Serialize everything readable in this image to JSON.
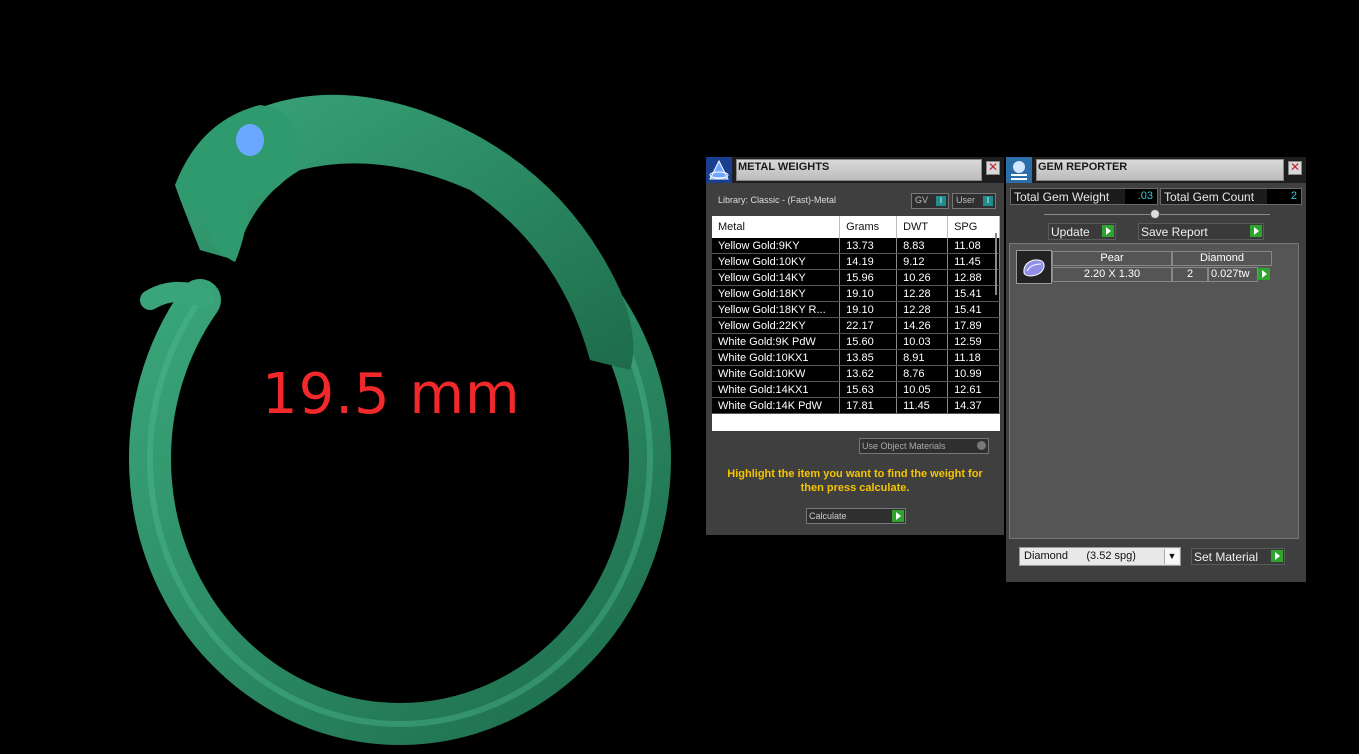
{
  "viewport": {
    "measurement": "19.5 mm",
    "ring_color": "#2b8a63",
    "eye_color": "#6aa8ff"
  },
  "metal_weights": {
    "title": "METAL WEIGHTS",
    "library": "Library: Classic - (Fast)-Metal",
    "gv_label": "GV",
    "user_label": "User",
    "toggle_glyph": "I",
    "columns": [
      "Metal",
      "Grams",
      "DWT",
      "SPG"
    ],
    "rows": [
      [
        "Yellow Gold:9KY",
        "13.73",
        "8.83",
        "11.08"
      ],
      [
        "Yellow Gold:10KY",
        "14.19",
        "9.12",
        "11.45"
      ],
      [
        "Yellow Gold:14KY",
        "15.96",
        "10.26",
        "12.88"
      ],
      [
        "Yellow Gold:18KY",
        "19.10",
        "12.28",
        "15.41"
      ],
      [
        "Yellow Gold:18KY R...",
        "19.10",
        "12.28",
        "15.41"
      ],
      [
        "Yellow Gold:22KY",
        "22.17",
        "14.26",
        "17.89"
      ],
      [
        "White Gold:9K PdW",
        "15.60",
        "10.03",
        "12.59"
      ],
      [
        "White Gold:10KX1",
        "13.85",
        "8.91",
        "11.18"
      ],
      [
        "White Gold:10KW",
        "13.62",
        "8.76",
        "10.99"
      ],
      [
        "White Gold:14KX1",
        "15.63",
        "10.05",
        "12.61"
      ],
      [
        "White Gold:14K PdW",
        "17.81",
        "11.45",
        "14.37"
      ]
    ],
    "use_object_materials": "Use Object Materials",
    "hint": "Highlight the item you want to find the weight for then press calculate.",
    "calculate_label": "Calculate",
    "close_glyph": "✕"
  },
  "gem_reporter": {
    "title": "GEM REPORTER",
    "total_weight_label": "Total Gem Weight",
    "total_weight_value": ".03",
    "total_count_label": "Total Gem Count",
    "total_count_value": "2",
    "update_label": "Update",
    "save_report_label": "Save Report",
    "gem": {
      "shape": "Pear",
      "material": "Diamond",
      "size": "2.20 X 1.30",
      "count": "2",
      "weight": "0.027tw"
    },
    "material_select": "Diamond      (3.52 spg)",
    "material_arrow": "▼",
    "set_material_label": "Set Material",
    "close_glyph": "✕"
  }
}
